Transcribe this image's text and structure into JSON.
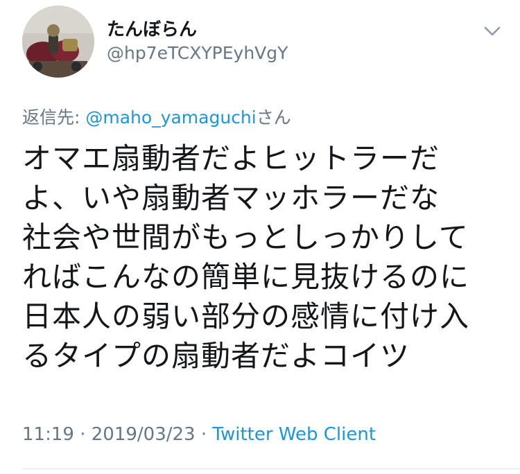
{
  "author": {
    "display_name": "たんぼらん",
    "handle": "@hp7eTCXYPEyhVgY",
    "avatar_icon": "avatar-photo-icon"
  },
  "menu": {
    "icon": "chevron-down-icon"
  },
  "reply": {
    "prefix": "返信先: ",
    "mention": "@maho_yamaguchi",
    "suffix": "さん"
  },
  "tweet": {
    "lines": [
      "オマエ扇動者だよヒットラーだ",
      "よ、いや扇動者マッホラーだな",
      "社会や世間がもっとしっかりして",
      "ればこんなの簡単に見抜けるのに",
      "日本人の弱い部分の感情に付け入",
      "るタイプの扇動者だよコイツ"
    ]
  },
  "meta": {
    "time": "11:19",
    "separator1": " · ",
    "date": "2019/03/23",
    "separator2": " · ",
    "client": "Twitter Web Client"
  },
  "colors": {
    "text": "#14171a",
    "secondary": "#657786",
    "link": "#1b95e0",
    "divider": "#e1e8ed"
  }
}
